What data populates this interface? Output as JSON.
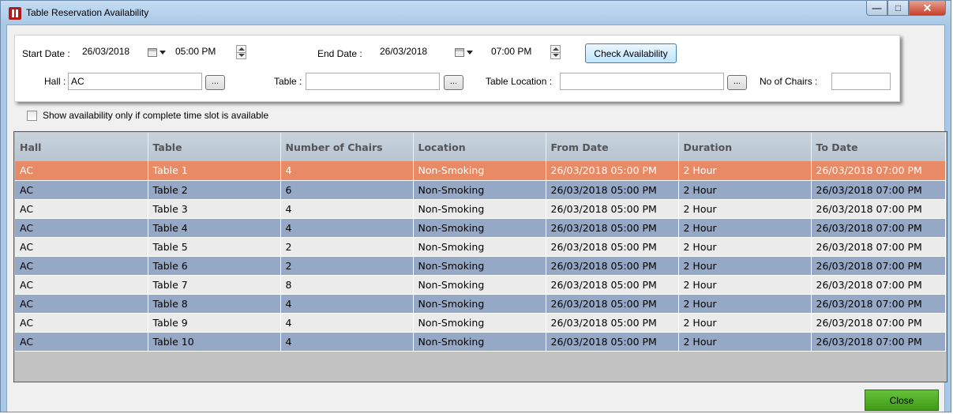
{
  "window": {
    "title": "Table Reservation Availability"
  },
  "filters": {
    "start_date_label": "Start Date :",
    "start_date": "26/03/2018",
    "start_time": "05:00 PM",
    "end_date_label": "End Date :",
    "end_date": "26/03/2018",
    "end_time": "07:00 PM",
    "check_button": "Check Availability",
    "hall_label": "Hall :",
    "hall_value": "AC",
    "table_label": "Table :",
    "table_value": "",
    "location_label": "Table Location :",
    "location_value": "",
    "chairs_label": "No of Chairs :",
    "chairs_value": "",
    "browse_label": "..."
  },
  "complete_slot_checkbox": {
    "label": "Show availability only if complete time slot is available",
    "checked": false
  },
  "grid": {
    "columns": [
      "Hall",
      "Table",
      "Number of Chairs",
      "Location",
      "From Date",
      "Duration",
      "To Date"
    ],
    "selected_row": 0,
    "rows": [
      [
        "AC",
        "Table 1",
        "4",
        "Non-Smoking",
        "26/03/2018 05:00 PM",
        "2 Hour",
        "26/03/2018 07:00 PM"
      ],
      [
        "AC",
        "Table 2",
        "6",
        "Non-Smoking",
        "26/03/2018 05:00 PM",
        "2 Hour",
        "26/03/2018 07:00 PM"
      ],
      [
        "AC",
        "Table 3",
        "4",
        "Non-Smoking",
        "26/03/2018 05:00 PM",
        "2 Hour",
        "26/03/2018 07:00 PM"
      ],
      [
        "AC",
        "Table 4",
        "4",
        "Non-Smoking",
        "26/03/2018 05:00 PM",
        "2 Hour",
        "26/03/2018 07:00 PM"
      ],
      [
        "AC",
        "Table 5",
        "2",
        "Non-Smoking",
        "26/03/2018 05:00 PM",
        "2 Hour",
        "26/03/2018 07:00 PM"
      ],
      [
        "AC",
        "Table 6",
        "2",
        "Non-Smoking",
        "26/03/2018 05:00 PM",
        "2 Hour",
        "26/03/2018 07:00 PM"
      ],
      [
        "AC",
        "Table 7",
        "8",
        "Non-Smoking",
        "26/03/2018 05:00 PM",
        "2 Hour",
        "26/03/2018 07:00 PM"
      ],
      [
        "AC",
        "Table 8",
        "4",
        "Non-Smoking",
        "26/03/2018 05:00 PM",
        "2 Hour",
        "26/03/2018 07:00 PM"
      ],
      [
        "AC",
        "Table 9",
        "4",
        "Non-Smoking",
        "26/03/2018 05:00 PM",
        "2 Hour",
        "26/03/2018 07:00 PM"
      ],
      [
        "AC",
        "Table 10",
        "4",
        "Non-Smoking",
        "26/03/2018 05:00 PM",
        "2 Hour",
        "26/03/2018 07:00 PM"
      ]
    ]
  },
  "footer": {
    "close_button": "Close"
  },
  "colors": {
    "selected_row": "#e88a66",
    "alt_row": "#95a9c6",
    "row": "#ebebeb",
    "close_button": "#4fae25"
  }
}
